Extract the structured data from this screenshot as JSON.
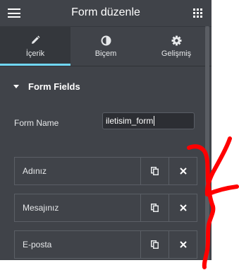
{
  "header": {
    "title": "Form düzenle",
    "menu_icon": "hamburger-menu-icon",
    "apps_icon": "grid-apps-icon"
  },
  "tabs": [
    {
      "label": "İçerik",
      "icon": "pencil-icon",
      "active": true
    },
    {
      "label": "Biçem",
      "icon": "half-circle-icon",
      "active": false
    },
    {
      "label": "Gelişmiş",
      "icon": "gear-icon",
      "active": false
    }
  ],
  "section": {
    "title": "Form Fields",
    "expanded": true
  },
  "form_name": {
    "label": "Form Name",
    "value": "iletisim_form"
  },
  "fields": [
    {
      "label": "Adınız"
    },
    {
      "label": "Mesajınız"
    },
    {
      "label": "E-posta"
    }
  ],
  "actions": {
    "duplicate_icon": "duplicate-icon",
    "remove_icon": "close-icon"
  },
  "colors": {
    "panel_bg": "#404349",
    "active_tab_bg": "#34373c",
    "accent": "#71d7f7",
    "annotation": "#ff0000"
  }
}
